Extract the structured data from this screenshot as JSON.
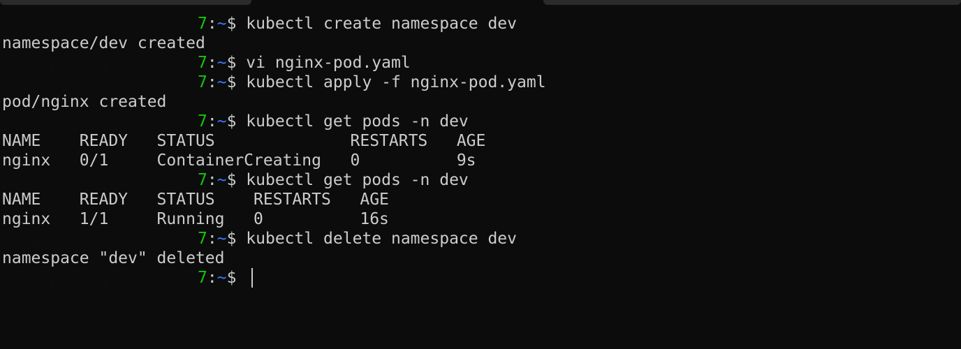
{
  "prompt": {
    "host_visible": "7",
    "sep": ":",
    "path": "~",
    "symbol": "$"
  },
  "lines": [
    {
      "type": "prompt",
      "command": "kubectl create namespace dev"
    },
    {
      "type": "output",
      "text": "namespace/dev created"
    },
    {
      "type": "prompt",
      "command": "vi nginx-pod.yaml"
    },
    {
      "type": "prompt",
      "command": "kubectl apply -f nginx-pod.yaml"
    },
    {
      "type": "output",
      "text": "pod/nginx created"
    },
    {
      "type": "prompt",
      "command": "kubectl get pods -n dev"
    },
    {
      "type": "output",
      "text": "NAME    READY   STATUS              RESTARTS   AGE"
    },
    {
      "type": "output",
      "text": "nginx   0/1     ContainerCreating   0          9s"
    },
    {
      "type": "prompt",
      "command": "kubectl get pods -n dev"
    },
    {
      "type": "output",
      "text": "NAME    READY   STATUS    RESTARTS   AGE"
    },
    {
      "type": "output",
      "text": "nginx   1/1     Running   0          16s"
    },
    {
      "type": "prompt",
      "command": "kubectl delete namespace dev"
    },
    {
      "type": "output",
      "text": "namespace \"dev\" deleted"
    },
    {
      "type": "prompt",
      "command": ""
    }
  ]
}
